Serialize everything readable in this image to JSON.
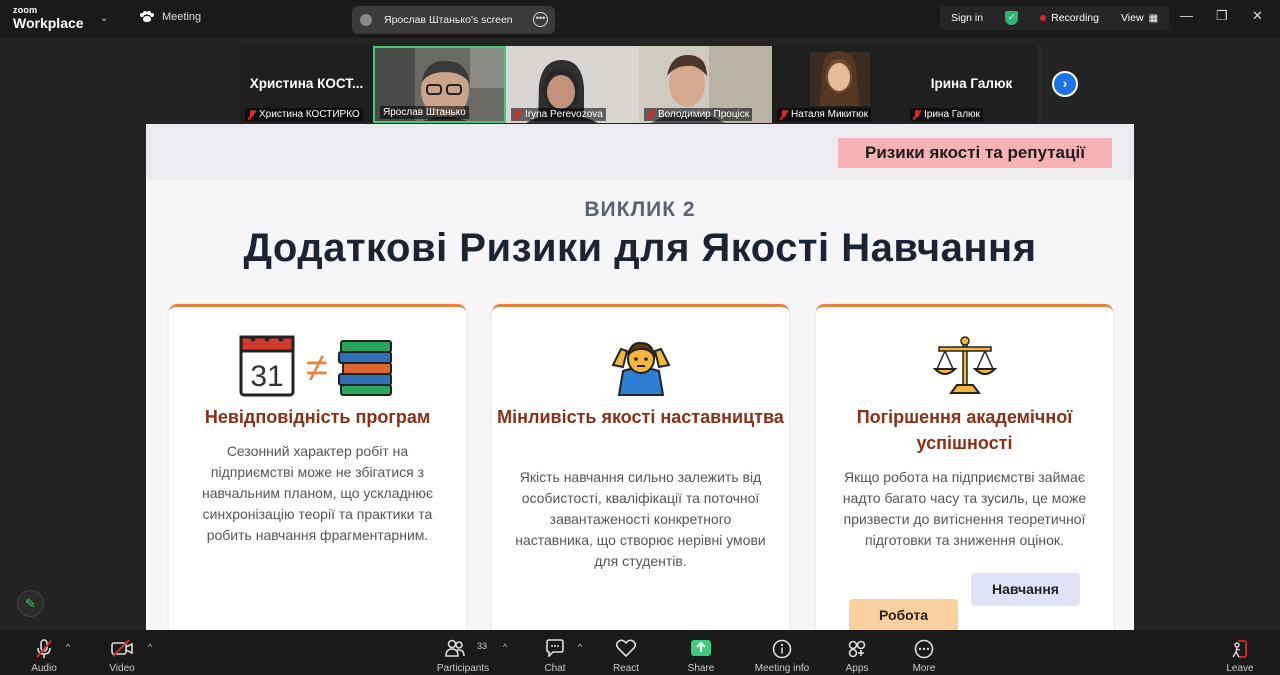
{
  "app": {
    "logo_line1": "zoom",
    "logo_line2": "Workplace",
    "meeting_label": "Meeting",
    "screen_tab_label": "Ярослав Штанько's screen",
    "sign_in": "Sign in",
    "recording": "Recording",
    "view": "View"
  },
  "participants_strip": [
    {
      "big_name": "Христина  КОСТ...",
      "caption": "Христина КОСТИРКО",
      "muted": true,
      "video": false
    },
    {
      "big_name": "",
      "caption": "Ярослав Штанько",
      "muted": false,
      "video": true,
      "active": true
    },
    {
      "big_name": "",
      "caption": "Iryna Perevozova",
      "muted": true,
      "video": true
    },
    {
      "big_name": "",
      "caption": "Володимир Проціск",
      "muted": true,
      "video": true
    },
    {
      "big_name": "",
      "caption": "Наталя Микитюк",
      "muted": true,
      "video": true
    },
    {
      "big_name": "Ірина Галюк",
      "caption": "Ірина Галюк",
      "muted": true,
      "video": false
    }
  ],
  "slide": {
    "tag": "Ризики якості та репутації",
    "subtitle": "ВИКЛИК 2",
    "headline": "Додаткові Ризики для Якості Навчання",
    "cards": [
      {
        "icon": "calendar-not-equal-books-icon",
        "calendar_day": "31",
        "title": "Невідповідність програм",
        "text": "Сезонний характер робіт на підприємстві може не збігатися з навчальним планом, що ускладнює синхронізацію теорії та практики та робить навчання фрагментарним."
      },
      {
        "icon": "person-shrugging-icon",
        "title": "Мінливість якості наставництва",
        "text": "Якість навчання сильно залежить від особистості, кваліфікації та поточної завантаженості конкретного наставника, що створює нерівні умови для студентів."
      },
      {
        "icon": "balance-scale-icon",
        "title": "Погіршення академічної успішності",
        "text": "Якщо робота на підприємстві займає надто багато часу та зусиль, це може призвести до витіснення теоретичної підготовки та зниження оцінок.",
        "pill_study": "Навчання",
        "pill_work": "Робота"
      }
    ]
  },
  "toolbar": {
    "audio": "Audio",
    "video": "Video",
    "participants": "Participants",
    "participants_count": "33",
    "chat": "Chat",
    "react": "React",
    "share": "Share",
    "meeting_info": "Meeting info",
    "apps": "Apps",
    "more": "More",
    "leave": "Leave"
  },
  "colors": {
    "accent_green": "#3ccd7a",
    "card_title": "#8b2f17",
    "card_border": "#e8823c",
    "tag_bg": "#f7b2b5"
  }
}
